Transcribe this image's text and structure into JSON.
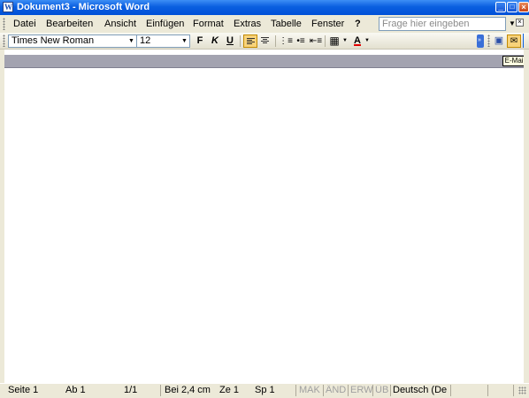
{
  "window": {
    "title": "Dokument3 - Microsoft Word",
    "icon": "word-document-icon",
    "controls": {
      "minimize": "minimize-icon",
      "maximize": "maximize-icon",
      "close": "close-icon"
    }
  },
  "menubar": {
    "items": [
      {
        "label": "Datei"
      },
      {
        "label": "Bearbeiten"
      },
      {
        "label": "Ansicht"
      },
      {
        "label": "Einfügen"
      },
      {
        "label": "Format"
      },
      {
        "label": "Extras"
      },
      {
        "label": "Tabelle"
      },
      {
        "label": "Fenster"
      },
      {
        "label": "?"
      }
    ],
    "help_placeholder": "Frage hier eingeben"
  },
  "toolbar": {
    "font_name": "Times New Roman",
    "font_size": "12",
    "bold_label": "F",
    "italic_label": "K",
    "underline_label": "U",
    "font_color_label": "A",
    "accent_highlight": "#f8d37a",
    "font_color": "#e00000"
  },
  "tooltip": {
    "text": "E-Mail"
  },
  "statusbar": {
    "page": "Seite 1",
    "section": "Ab 1",
    "pages": "1/1",
    "position": "Bei 2,4 cm",
    "line": "Ze 1",
    "column": "Sp 1",
    "rec": "MAK",
    "trk": "ÄND",
    "ext": "ERW",
    "ovr": "ÜB",
    "language": "Deutsch (De"
  }
}
